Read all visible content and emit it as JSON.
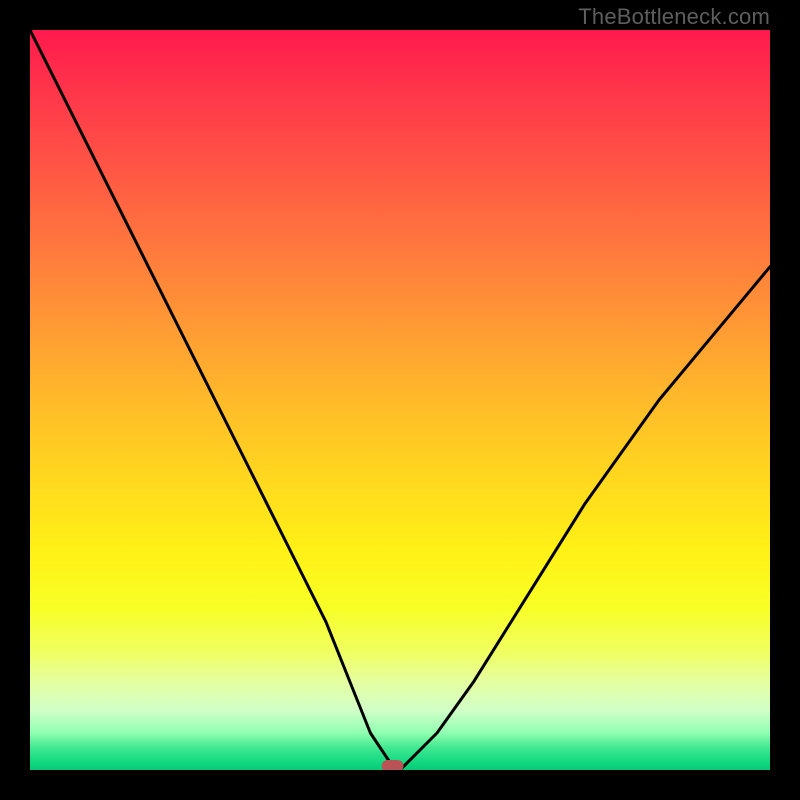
{
  "watermark": "TheBottleneck.com",
  "chart_data": {
    "type": "line",
    "title": "",
    "xlabel": "",
    "ylabel": "",
    "xlim": [
      0,
      100
    ],
    "ylim": [
      0,
      100
    ],
    "grid": false,
    "series": [
      {
        "name": "bottleneck-curve",
        "x": [
          0,
          5,
          10,
          15,
          20,
          25,
          30,
          35,
          40,
          44,
          46,
          48,
          49,
          50,
          55,
          60,
          65,
          70,
          75,
          80,
          85,
          90,
          95,
          100
        ],
        "y": [
          100,
          90,
          80,
          70,
          60,
          50,
          40,
          30,
          20,
          10,
          5,
          2,
          0.5,
          0,
          5,
          12,
          20,
          28,
          36,
          43,
          50,
          56,
          62,
          68
        ]
      }
    ],
    "marker": {
      "x": 49,
      "y": 0,
      "shape": "pill",
      "color": "#b85455"
    },
    "background_gradient": {
      "top": "#ff1a4d",
      "mid": "#ffd61f",
      "bottom": "#08c878"
    }
  }
}
